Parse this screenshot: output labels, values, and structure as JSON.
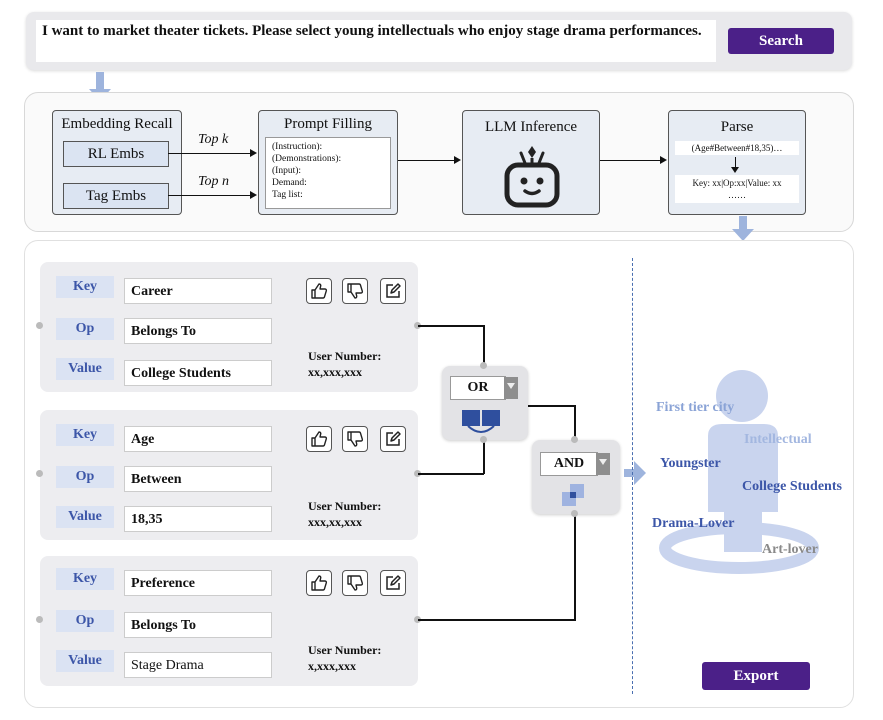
{
  "query": {
    "text": "I want to market theater tickets. Please select young intellectuals who enjoy stage drama performances.",
    "search_label": "Search"
  },
  "pipeline": {
    "embedding_recall": "Embedding Recall",
    "rl_embs": "RL Embs",
    "tag_embs": "Tag Embs",
    "top_k": "Top k",
    "top_n": "Top n",
    "prompt_filling": "Prompt Filling",
    "prompt_lines": [
      "(Instruction):",
      "(Demonstrations):",
      "(Input):",
      "Demand:",
      "Tag list:"
    ],
    "llm_inference": "LLM Inference",
    "parse": "Parse",
    "parse_in": "(Age#Between#18,35)…",
    "parse_out": "Key: xx|Op:xx|Value: xx",
    "parse_more": "……"
  },
  "rules": [
    {
      "key_label": "Key",
      "op_label": "Op",
      "value_label": "Value",
      "key": "Career",
      "op": "Belongs To",
      "value": "College Students",
      "user_number_label": "User Number:",
      "user_number": "xx,xxx,xxx"
    },
    {
      "key_label": "Key",
      "op_label": "Op",
      "value_label": "Value",
      "key": "Age",
      "op": "Between",
      "value": "18,35",
      "user_number_label": "User Number:",
      "user_number": "xxx,xx,xxx"
    },
    {
      "key_label": "Key",
      "op_label": "Op",
      "value_label": "Value",
      "key": "Preference",
      "op": "Belongs To",
      "value": "Stage Drama",
      "user_number_label": "User Number:",
      "user_number": "x,xxx,xxx"
    }
  ],
  "operators": {
    "or": "OR",
    "and": "AND"
  },
  "persona": {
    "first_tier_city": "First tier city",
    "intellectual": "Intellectual",
    "youngster": "Youngster",
    "college_students": "College Students",
    "drama_lover": "Drama-Lover",
    "art_lover": "Art-lover"
  },
  "export_label": "Export",
  "colors": {
    "accent": "#4b2088",
    "label_bg": "#dbe3f3",
    "label_text": "#3c56a8",
    "arrow": "#9eb4dd"
  }
}
